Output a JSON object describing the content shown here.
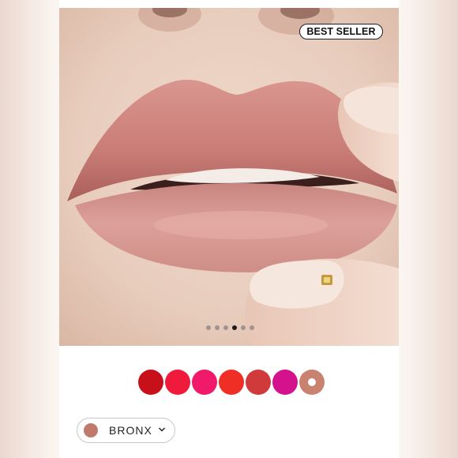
{
  "badge": {
    "text": "BEST SELLER"
  },
  "carousel": {
    "count": 6,
    "active_index": 3
  },
  "swatches": [
    {
      "name": "red",
      "color": "#c8101a"
    },
    {
      "name": "bright-red",
      "color": "#ef1a3c"
    },
    {
      "name": "pink",
      "color": "#f0196a"
    },
    {
      "name": "orange-red",
      "color": "#ef2f26"
    },
    {
      "name": "brick",
      "color": "#d13a3a"
    },
    {
      "name": "magenta",
      "color": "#d4128e"
    },
    {
      "name": "nude",
      "color": "#c98270",
      "selected": true
    }
  ],
  "shade_selector": {
    "label": "BRONX",
    "chip_color": "#c07a6b",
    "icon": "chevron-down-icon"
  }
}
